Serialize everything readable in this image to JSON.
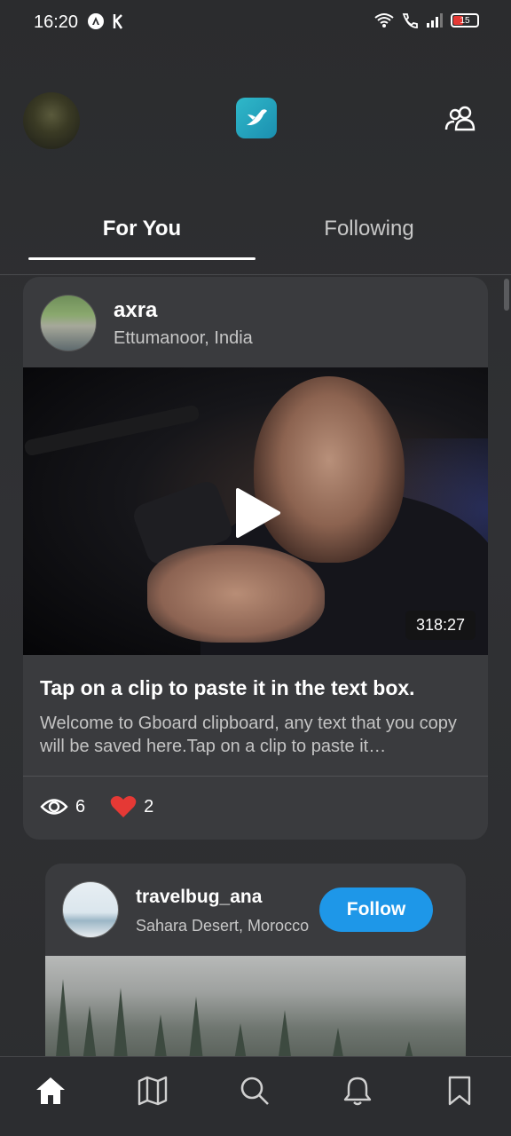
{
  "status_bar": {
    "time": "16:20",
    "battery": "15"
  },
  "tabs": [
    {
      "label": "For You",
      "active": true
    },
    {
      "label": "Following",
      "active": false
    }
  ],
  "posts": [
    {
      "username": "axra",
      "location": "Ettumanoor, India",
      "duration": "318:27",
      "title": "Tap on a clip to paste it in the text box.",
      "description": "Welcome to Gboard clipboard, any text that you copy will be saved here.Tap on a clip to paste it…",
      "views": "6",
      "likes": "2"
    },
    {
      "username": "travelbug_ana",
      "location": "Sahara Desert, Morocco",
      "follow_label": "Follow"
    }
  ],
  "nav": [
    {
      "icon": "home-icon",
      "active": true
    },
    {
      "icon": "map-icon",
      "active": false
    },
    {
      "icon": "search-icon",
      "active": false
    },
    {
      "icon": "bell-icon",
      "active": false
    },
    {
      "icon": "bookmark-icon",
      "active": false
    }
  ],
  "colors": {
    "accent": "#1e97e8",
    "like": "#e53935",
    "logo": "#2fb8c9"
  }
}
